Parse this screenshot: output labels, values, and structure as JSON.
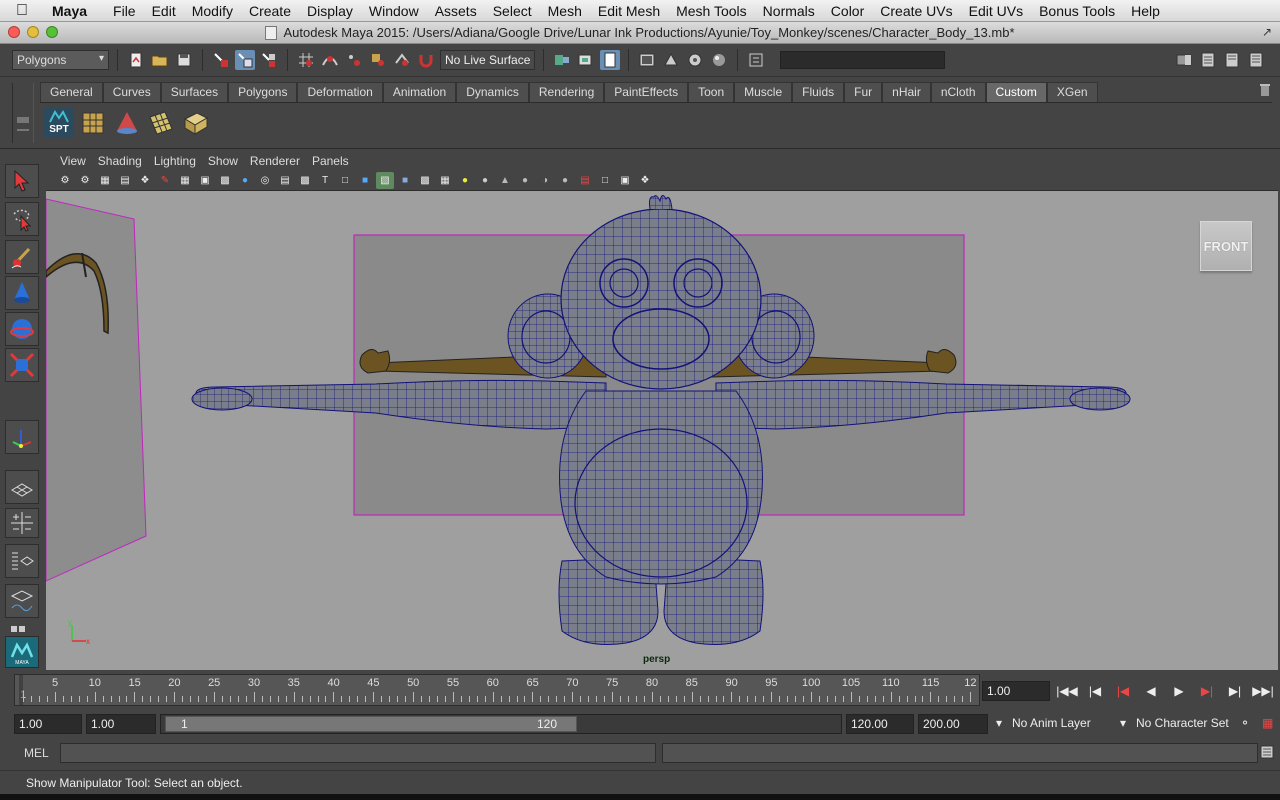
{
  "menubar": {
    "app": "Maya",
    "items": [
      "File",
      "Edit",
      "Modify",
      "Create",
      "Display",
      "Window",
      "Assets",
      "Select",
      "Mesh",
      "Edit Mesh",
      "Mesh Tools",
      "Normals",
      "Color",
      "Create UVs",
      "Edit UVs",
      "Bonus Tools",
      "Help"
    ]
  },
  "window": {
    "title": "Autodesk Maya 2015: /Users/Adiana/Google Drive/Lunar Ink Productions/Ayunie/Toy_Monkey/scenes/Character_Body_13.mb*"
  },
  "statusline": {
    "mode": "Polygons",
    "live_surface": "No Live Surface"
  },
  "shelf": {
    "tabs": [
      "General",
      "Curves",
      "Surfaces",
      "Polygons",
      "Deformation",
      "Animation",
      "Dynamics",
      "Rendering",
      "PaintEffects",
      "Toon",
      "Muscle",
      "Fluids",
      "Fur",
      "nHair",
      "nCloth",
      "Custom",
      "XGen"
    ],
    "active_tab": "Custom",
    "spt_label": "SPT"
  },
  "panel": {
    "menus": [
      "View",
      "Shading",
      "Lighting",
      "Show",
      "Renderer",
      "Panels"
    ],
    "camera_label": "persp",
    "viewcube_label": "FRONT"
  },
  "timeline": {
    "labels": [
      "1",
      "5",
      "10",
      "15",
      "20",
      "25",
      "30",
      "35",
      "40",
      "45",
      "50",
      "55",
      "60",
      "65",
      "70",
      "75",
      "80",
      "85",
      "90",
      "95",
      "100",
      "105",
      "110",
      "115",
      "12"
    ],
    "current_frame": "1.00"
  },
  "range": {
    "start": "1.00",
    "playback_start": "1.00",
    "slider_start": "1",
    "slider_end": "120",
    "playback_end": "120.00",
    "end": "200.00",
    "anim_layer": "No Anim Layer",
    "character_set": "No Character Set"
  },
  "commandline": {
    "label": "MEL"
  },
  "helpline": {
    "text": "Show Manipulator Tool: Select an object."
  },
  "colors": {
    "wire": "#12127a",
    "mesh": "#7d7f8c",
    "highlight": "#c026c0",
    "image_plane": "#8a8a8a",
    "brown": "#6b5422"
  }
}
